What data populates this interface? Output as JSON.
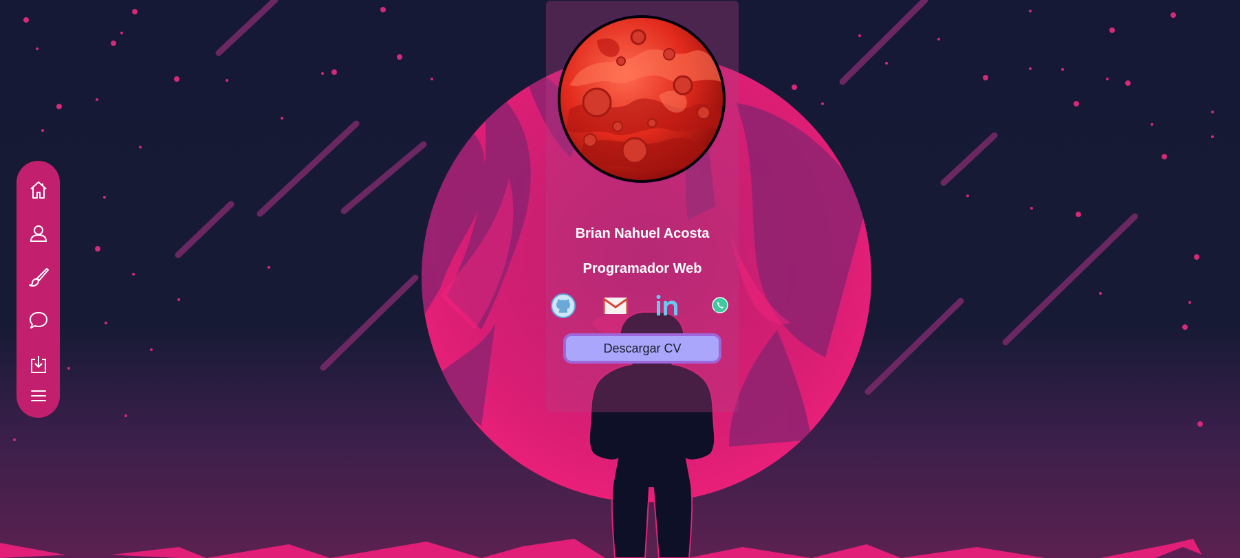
{
  "profile": {
    "name": "Brian Nahuel Acosta",
    "role": "Programador Web",
    "cv_button": "Descargar CV"
  },
  "nav": {
    "items": [
      {
        "icon": "home-icon"
      },
      {
        "icon": "user-icon"
      },
      {
        "icon": "brush-icon"
      },
      {
        "icon": "chat-icon"
      },
      {
        "icon": "download-icon"
      },
      {
        "icon": "menu-icon"
      }
    ]
  },
  "social": {
    "items": [
      {
        "icon": "github-icon"
      },
      {
        "icon": "gmail-icon"
      },
      {
        "icon": "linkedin-icon"
      },
      {
        "icon": "whatsapp-icon"
      }
    ]
  },
  "colors": {
    "background": "#161a35",
    "accent": "#c2206f",
    "button": "#a9a6fb"
  }
}
